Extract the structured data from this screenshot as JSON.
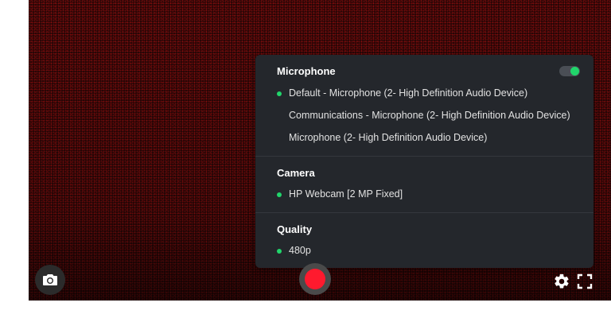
{
  "settings_panel": {
    "microphone": {
      "title": "Microphone",
      "toggle_on": true,
      "options": [
        {
          "label": "Default - Microphone (2- High Definition Audio Device)",
          "selected": true
        },
        {
          "label": "Communications - Microphone (2- High Definition Audio Device)",
          "selected": false
        },
        {
          "label": "Microphone (2- High Definition Audio Device)",
          "selected": false
        }
      ]
    },
    "camera": {
      "title": "Camera",
      "options": [
        {
          "label": "HP Webcam [2 MP Fixed]",
          "selected": true
        }
      ]
    },
    "quality": {
      "title": "Quality",
      "options": [
        {
          "label": "480p",
          "selected": true
        }
      ]
    }
  },
  "controls": {
    "snapshot_icon": "camera-icon",
    "record_icon": "record-icon",
    "settings_icon": "gear-icon",
    "fullscreen_icon": "fullscreen-icon"
  },
  "colors": {
    "accent_green": "#21d56b",
    "record_red": "#ff1a2e",
    "panel_bg": "#24272c"
  }
}
